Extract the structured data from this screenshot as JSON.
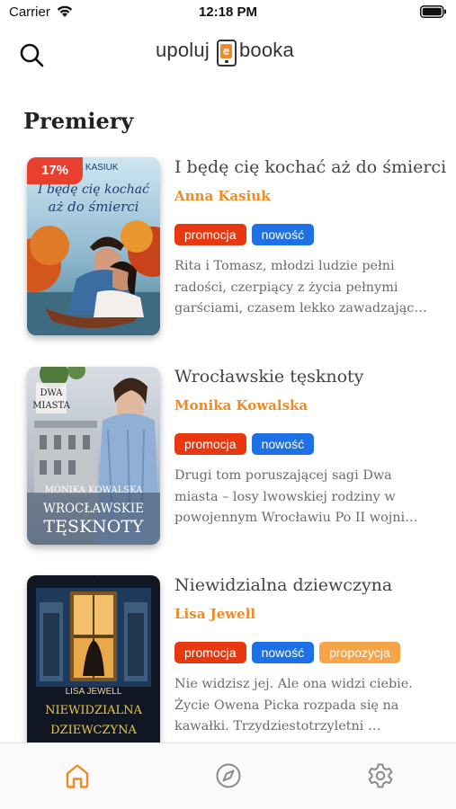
{
  "status": {
    "carrier": "Carrier",
    "time": "12:18 PM"
  },
  "header": {
    "logo_left": "upoluj",
    "logo_mark": "e",
    "logo_right": "booka"
  },
  "section_title": "Premiery",
  "colors": {
    "accent": "#f08a24",
    "promo": "#e8380f",
    "new": "#1e70e6",
    "proposal": "#f5a548",
    "badge": "#e93f2f"
  },
  "books": [
    {
      "title": "I będę cię kochać aż do śmierci",
      "author": "Anna Kasiuk",
      "discount": "17%",
      "tags": [
        "promocja",
        "nowość"
      ],
      "desc": [
        "Rita i Tomasz, młodzi ludzie pełni",
        "radości, czerpiący z życia pełnymi",
        "garściami, czasem lekko zawadzając…"
      ],
      "cover": {
        "top": "A KASIUK",
        "title_line1": "I będę cię kochać",
        "title_line2": "aż do śmierci"
      }
    },
    {
      "title": "Wrocławskie tęsknoty",
      "author": "Monika Kowalska",
      "tags": [
        "promocja",
        "nowość"
      ],
      "desc": [
        "Drugi tom poruszającej sagi Dwa",
        "miasta – losy lwowskiej rodziny w",
        "powojennym Wrocławiu Po II wojni…"
      ],
      "cover": {
        "series1": "DWA",
        "series2": "MIASTA",
        "author": "MONIKA KOWALSKA",
        "title1": "WROCŁAWSKIE",
        "title2": "TĘSKNOTY"
      }
    },
    {
      "title": "Niewidzialna dziewczyna",
      "author": "Lisa Jewell",
      "tags": [
        "promocja",
        "nowość",
        "propozycja"
      ],
      "desc": [
        "Nie widzisz jej. Ale ona widzi ciebie.",
        "Życie Owena Picka rozpada się na",
        "kawałki. Trzydziestotrzyletni …"
      ],
      "cover": {
        "author": "LISA JEWELL",
        "title1": "NIEWIDZIALNA",
        "title2": "DZIEWCZYNA"
      }
    }
  ],
  "tabbar": {
    "items": [
      "home-icon",
      "compass-icon",
      "gear-icon"
    ]
  }
}
